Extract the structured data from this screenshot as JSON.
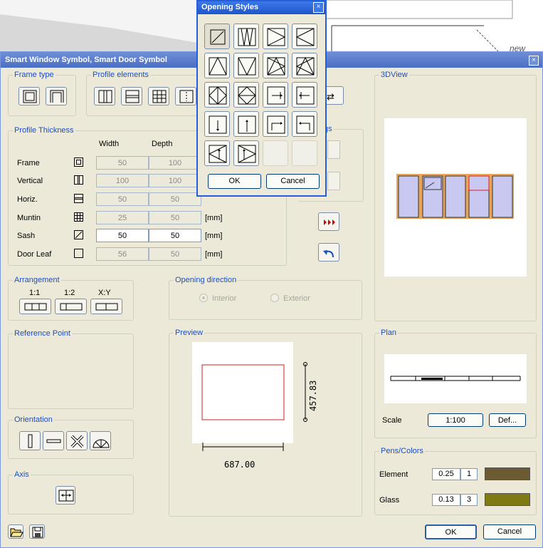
{
  "background": {
    "drawing_label": "new"
  },
  "main_dialog": {
    "title": "Smart Window Symbol, Smart Door Symbol",
    "close_glyph": "×",
    "frame_type": {
      "title": "Frame type"
    },
    "profile_elements": {
      "title": "Profile elements"
    },
    "profile_thickness": {
      "title": "Profile Thickness",
      "col_width": "Width",
      "col_depth": "Depth",
      "rows": [
        {
          "label": "Frame",
          "width": "50",
          "depth": "100",
          "unit": "",
          "icon": "frame-icon",
          "enabled": false
        },
        {
          "label": "Vertical",
          "width": "100",
          "depth": "100",
          "unit": "",
          "icon": "vertical-icon",
          "enabled": false
        },
        {
          "label": "Horiz.",
          "width": "50",
          "depth": "50",
          "unit": "",
          "icon": "horizontal-icon",
          "enabled": false
        },
        {
          "label": "Muntin",
          "width": "25",
          "depth": "50",
          "unit": "[mm]",
          "icon": "muntin-icon",
          "enabled": false
        },
        {
          "label": "Sash",
          "width": "50",
          "depth": "50",
          "unit": "[mm]",
          "icon": "sash-icon",
          "enabled": true
        },
        {
          "label": "Door Leaf",
          "width": "56",
          "depth": "50",
          "unit": "[mm]",
          "icon": "door-leaf-icon",
          "enabled": false
        }
      ]
    },
    "settings_partial_title": "gs",
    "arrangement": {
      "title": "Arrangement",
      "labels": [
        "1:1",
        "1:2",
        "X:Y"
      ]
    },
    "opening_direction": {
      "title": "Opening direction",
      "interior": "Interior",
      "exterior": "Exterior",
      "selected": "Interior"
    },
    "reference_point": {
      "title": "Reference Point"
    },
    "orientation": {
      "title": "Orientation"
    },
    "axis": {
      "title": "Axis"
    },
    "preview": {
      "title": "Preview",
      "height_dim": "457.83",
      "width_dim": "687.00"
    },
    "view3d": {
      "title": "3DView"
    },
    "plan": {
      "title": "Plan",
      "scale_label": "Scale",
      "scale_value": "1:100",
      "def_button": "Def..."
    },
    "pens_colors": {
      "title": "Pens/Colors",
      "rows": [
        {
          "label": "Element",
          "pen": "0.25",
          "num": "1",
          "color": "#6b5a32"
        },
        {
          "label": "Glass",
          "pen": "0.13",
          "num": "3",
          "color": "#7f7a14"
        }
      ]
    },
    "ok_button": "OK",
    "cancel_button": "Cancel"
  },
  "opening_styles": {
    "title": "Opening Styles",
    "close_glyph": "×",
    "ok_button": "OK",
    "cancel_button": "Cancel"
  },
  "colors": {
    "accent": "#1c4fc0",
    "title_bar": "#4a6fc4",
    "preview_outline": "#cc2222",
    "glass": "#c8c8f0"
  }
}
